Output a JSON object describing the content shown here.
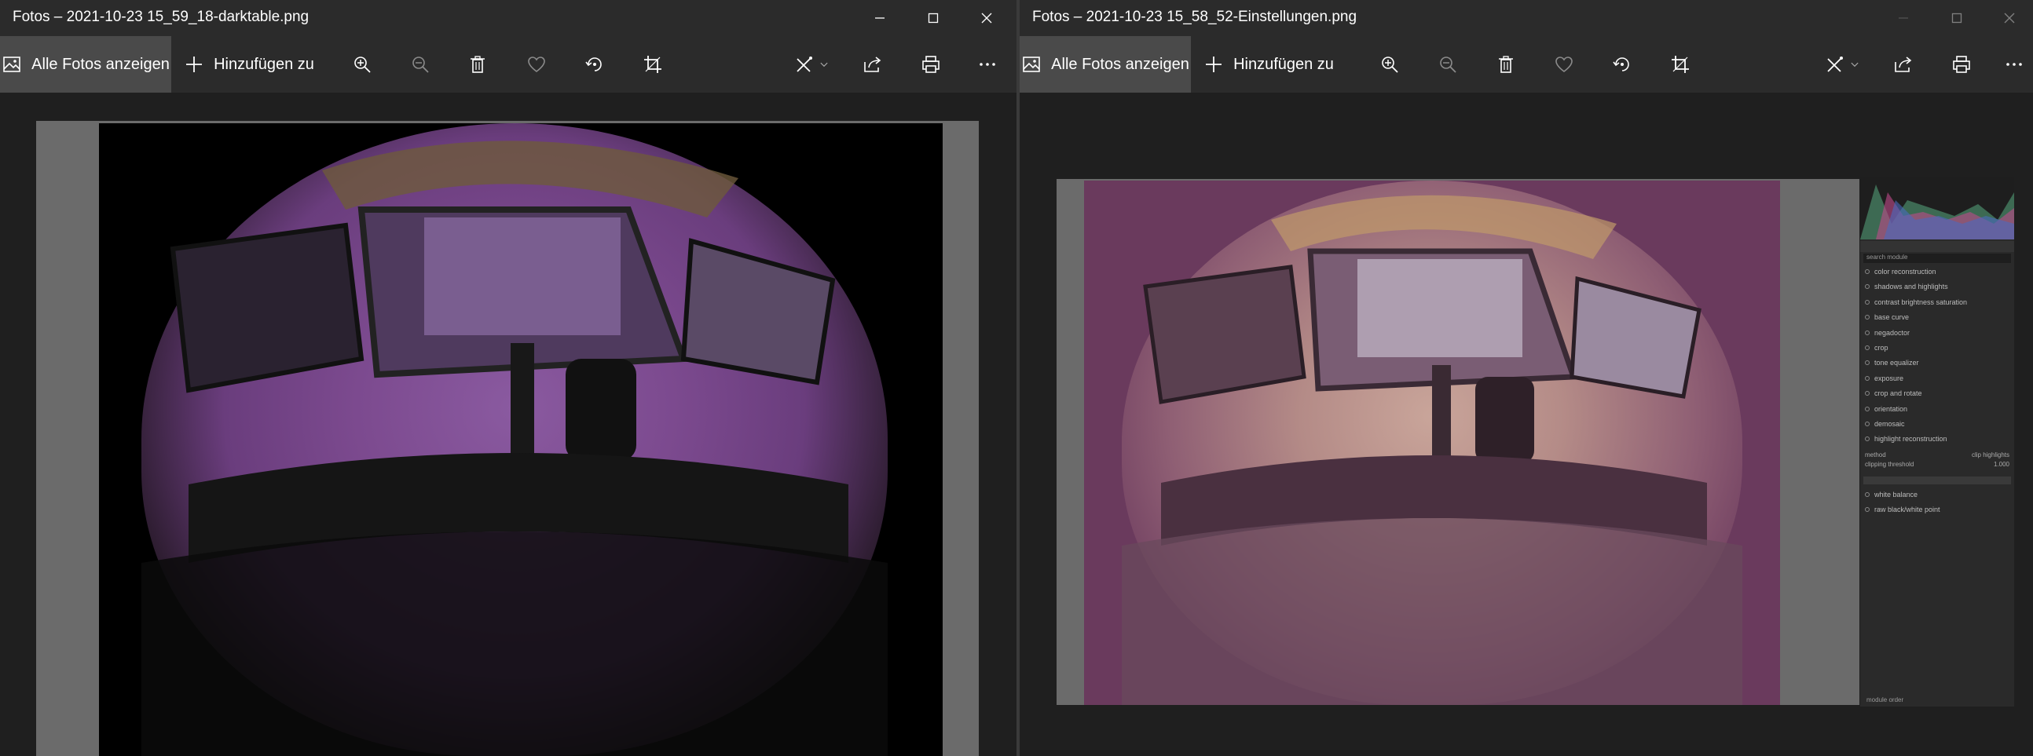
{
  "left_window": {
    "title": "Fotos – 2021-10-23 15_59_18-darktable.png",
    "toolbar": {
      "show_all_label": "Alle Fotos anzeigen",
      "add_to_label": "Hinzufügen zu"
    }
  },
  "right_window": {
    "title": "Fotos – 2021-10-23 15_58_52-Einstellungen.png",
    "toolbar": {
      "show_all_label": "Alle Fotos anzeigen",
      "add_to_label": "Hinzufügen zu"
    },
    "darktable_panel": {
      "search_placeholder": "search module",
      "modules": [
        "color reconstruction",
        "shadows and highlights",
        "contrast brightness saturation",
        "base curve",
        "negadoctor",
        "crop",
        "tone equalizer",
        "exposure",
        "crop and rotate",
        "orientation",
        "demosaic",
        "highlight reconstruction"
      ],
      "method_label": "method",
      "method_value": "clip highlights",
      "clipping_label": "clipping threshold",
      "clipping_value": "1.000",
      "modules_after": [
        "white balance",
        "raw black/white point"
      ],
      "module_order_label": "module order"
    }
  },
  "colors": {
    "titlebar_bg": "#2b2b2b",
    "active_button_bg": "#4a4a4a",
    "canvas_gray": "#6b6b6b",
    "left_tint": "#7c4a8f",
    "right_tint": "#6c3b5e"
  }
}
